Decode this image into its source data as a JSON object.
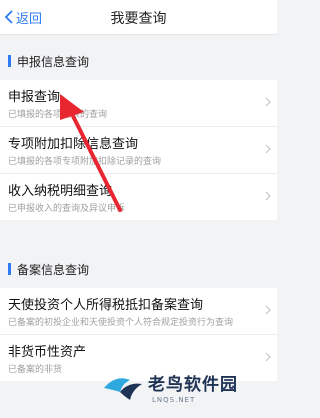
{
  "nav": {
    "back_label": "返回",
    "title": "我要查询"
  },
  "sections": [
    {
      "title": "申报信息查询",
      "items": [
        {
          "title": "申报查询",
          "subtitle": "已填报的各项报表的查询"
        },
        {
          "title": "专项附加扣除信息查询",
          "subtitle": "已填报的各项专项附加扣除记录的查询"
        },
        {
          "title": "收入纳税明细查询",
          "subtitle": "已申报收入的查询及异议申诉"
        }
      ]
    },
    {
      "title": "备案信息查询",
      "items": [
        {
          "title": "天使投资个人所得税抵扣备案查询",
          "subtitle": "已备案的初投企业和天使投资个人符合规定投资行为查询"
        },
        {
          "title": "非货币性资产",
          "subtitle": "已备案的非货"
        }
      ]
    }
  ],
  "watermark": {
    "text": "老鸟软件园",
    "sub": "LNQS.NET"
  },
  "colors": {
    "accent": "#2f7bf5",
    "annotation_arrow": "#e8262f"
  },
  "icons": [
    "chevron-left-icon",
    "chevron-right-icon",
    "bird-logo-icon"
  ]
}
